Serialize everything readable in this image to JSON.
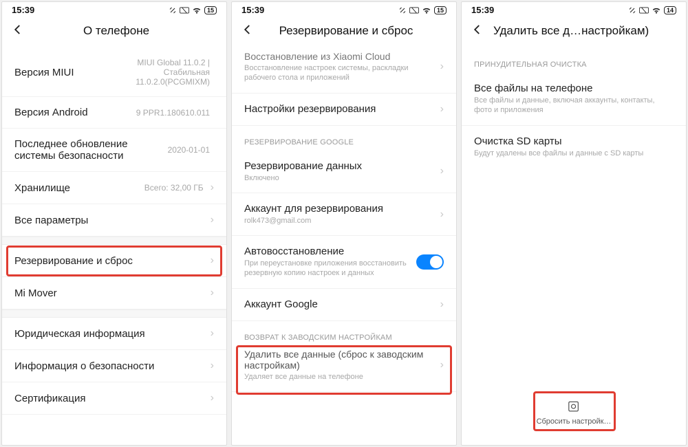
{
  "statusbar": {
    "time": "15:39",
    "battery": "15",
    "battery3": "14"
  },
  "screen1": {
    "title": "О телефоне",
    "rows": [
      {
        "label": "Версия MIUI",
        "value": "MIUI Global 11.0.2 |\nСтабильная\n11.0.2.0(PCGMIXM)"
      },
      {
        "label": "Версия Android",
        "value": "9 PPR1.180610.011"
      },
      {
        "label": "Последнее обновление системы безопасности",
        "value": "2020-01-01"
      },
      {
        "label": "Хранилище",
        "value": "Всего: 32,00 ГБ",
        "chev": true
      },
      {
        "label": "Все параметры",
        "chev": true
      }
    ],
    "rows2": [
      {
        "label": "Резервирование и сброс",
        "chev": true,
        "highlight": true
      },
      {
        "label": "Mi Mover",
        "chev": true
      }
    ],
    "rows3": [
      {
        "label": "Юридическая информация",
        "chev": true
      },
      {
        "label": "Информация о безопасности",
        "chev": true
      },
      {
        "label": "Сертификация",
        "chev": true
      }
    ]
  },
  "screen2": {
    "title": "Резервирование и сброс",
    "topRow": {
      "label": "Восстановление из Xiaomi Cloud",
      "sub": "Восстановление настроек системы, раскладки рабочего стола и приложений"
    },
    "row2": {
      "label": "Настройки резервирования"
    },
    "section_google": "РЕЗЕРВИРОВАНИЕ GOOGLE",
    "g1": {
      "label": "Резервирование данных",
      "sub": "Включено"
    },
    "g2": {
      "label": "Аккаунт для резервирования",
      "sub": "rolk473@gmail.com"
    },
    "g3": {
      "label": "Автовосстановление",
      "sub": "При переустановке приложения восстановить резервную копию настроек и данных"
    },
    "g4": {
      "label": "Аккаунт Google"
    },
    "section_factory": "ВОЗВРАТ К ЗАВОДСКИМ НАСТРОЙКАМ",
    "f1": {
      "label": "Удалить все данные (сброс к заводским настройкам)",
      "sub": "Удаляет все данные на телефоне"
    }
  },
  "screen3": {
    "title": "Удалить все д…настройкам)",
    "section": "ПРИНУДИТЕЛЬНАЯ ОЧИСТКА",
    "r1": {
      "label": "Все файлы на телефоне",
      "sub": "Все файлы и данные, включая аккаунты, контакты, фото и приложения"
    },
    "r2": {
      "label": "Очистка SD карты",
      "sub": "Будут удалены все файлы и данные с SD карты"
    },
    "action": "Сбросить настройк…"
  }
}
